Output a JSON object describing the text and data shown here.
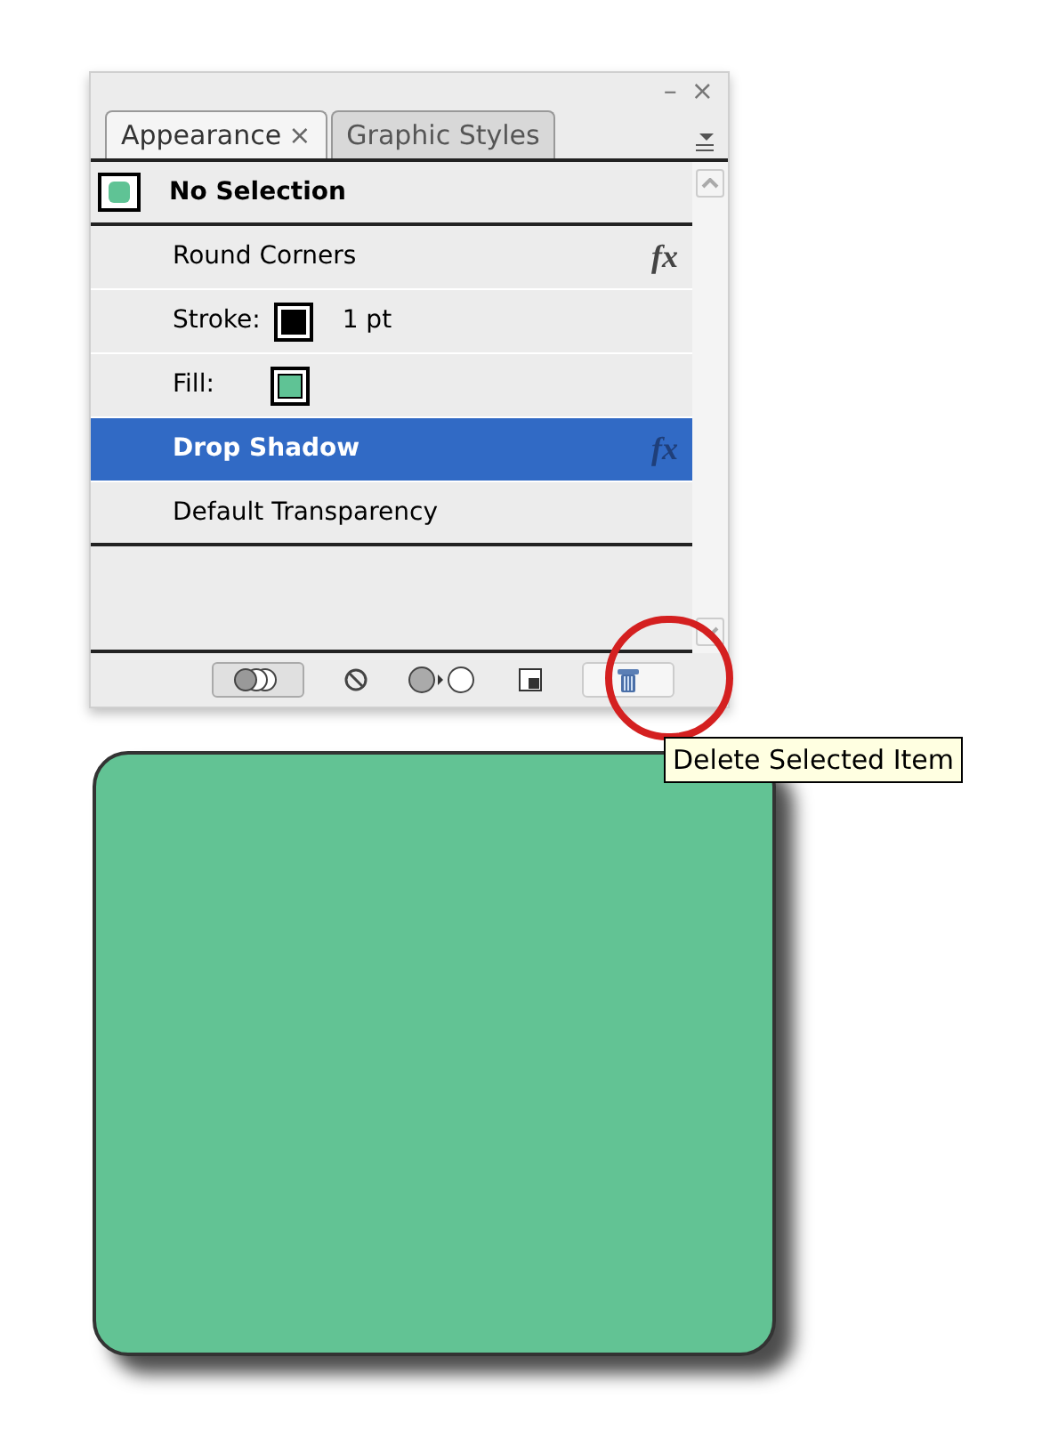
{
  "window_controls": {
    "minimize": "–",
    "close": "×"
  },
  "tabs": [
    {
      "label": "Appearance",
      "close": "×",
      "selected": true
    },
    {
      "label": "Graphic Styles",
      "selected": false
    }
  ],
  "rows": [
    {
      "kind": "header",
      "label": "No Selection",
      "selected": false
    },
    {
      "kind": "effect",
      "label": "Round Corners",
      "fx": "fx",
      "selected": false
    },
    {
      "kind": "stroke",
      "label": "Stroke:",
      "value": "1 pt",
      "color": "#000000",
      "selected": false
    },
    {
      "kind": "fill",
      "label": "Fill:",
      "color": "#5fc395",
      "selected": false
    },
    {
      "kind": "effect",
      "label": "Drop Shadow",
      "fx": "fx",
      "selected": true
    },
    {
      "kind": "plain",
      "label": "Default Transparency",
      "selected": false
    }
  ],
  "tooltip": "Delete Selected Item"
}
